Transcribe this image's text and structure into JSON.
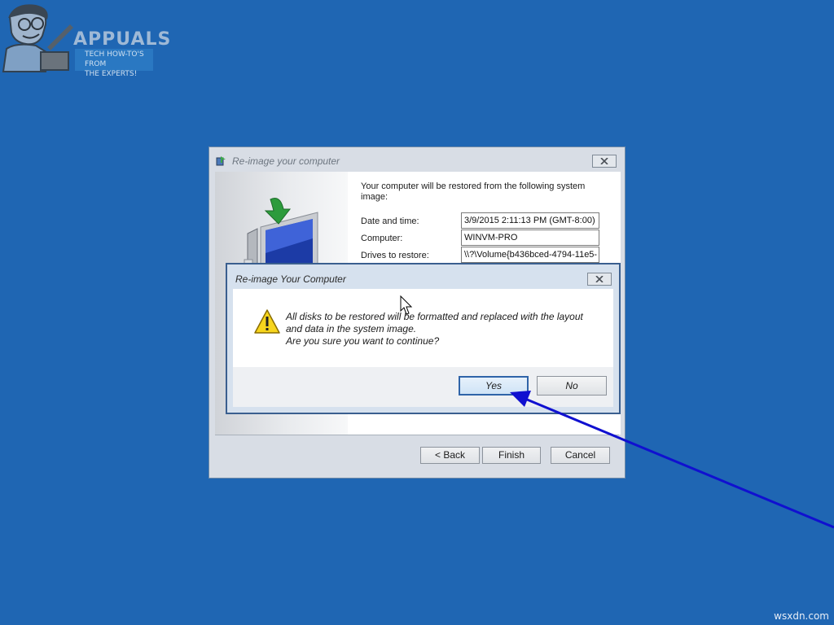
{
  "watermark_logo": {
    "word": "APPUALS",
    "tagline_line1": "TECH HOW-TO'S FROM",
    "tagline_line2": "THE EXPERTS!"
  },
  "site_watermark": "wsxdn.com",
  "wizard": {
    "title": "Re-image your computer",
    "intro": "Your computer will be restored from the following system image:",
    "fields": [
      {
        "label": "Date and time:",
        "value": "3/9/2015 2:11:13 PM (GMT-8:00)"
      },
      {
        "label": "Computer:",
        "value": "WINVM-PRO"
      },
      {
        "label": "Drives to restore:",
        "value": "\\\\?\\Volume{b436bced-4794-11e5-"
      }
    ],
    "buttons": {
      "back": "< Back",
      "finish": "Finish",
      "cancel": "Cancel"
    }
  },
  "confirm": {
    "title": "Re-image Your Computer",
    "message_line1": "All disks to be restored will be formatted and replaced with the layout",
    "message_line2": "and data in the system image.",
    "message_line3": "Are you sure you want to continue?",
    "yes_label": "Yes",
    "no_label": "No"
  },
  "icons": {
    "wizard_title": "backup-restore-icon",
    "wizard_art": "computer-restore-icon",
    "close": "close-icon",
    "warning": "warning-icon",
    "cursor": "mouse-pointer-icon",
    "annotation": "annotation-arrow-icon"
  },
  "colors": {
    "desktop": "#1f66b3",
    "annotation_arrow": "#1010d0",
    "warning_fill": "#f7d51d"
  }
}
